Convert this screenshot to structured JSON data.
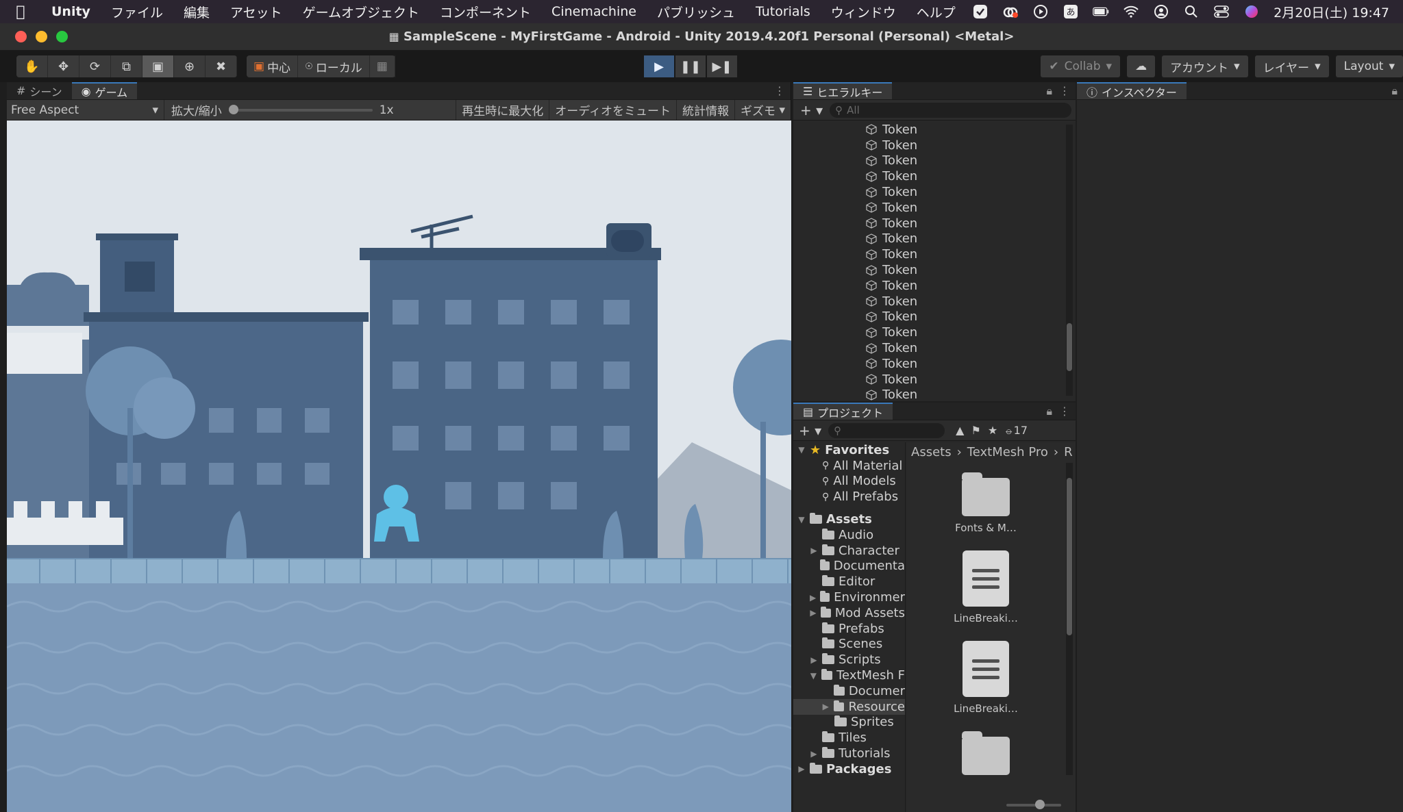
{
  "menubar": {
    "items": [
      "Unity",
      "ファイル",
      "編集",
      "アセット",
      "ゲームオブジェクト",
      "コンポーネント",
      "Cinemachine",
      "パブリッシュ",
      "Tutorials",
      "ウィンドウ",
      "ヘルプ"
    ],
    "clock": "2月20日(土)  19:47",
    "icons": [
      "checkmark-icon",
      "creative-cloud-icon",
      "play-circle-icon",
      "input-method-icon",
      "battery-icon",
      "wifi-icon",
      "user-icon",
      "search-icon",
      "control-center-icon",
      "siri-icon"
    ]
  },
  "window": {
    "title": "SampleScene - MyFirstGame - Android - Unity 2019.4.20f1 Personal (Personal) <Metal>"
  },
  "toolbar": {
    "pivot_label": "中心",
    "space_label": "ローカル",
    "collab_label": "Collab",
    "account_label": "アカウント",
    "layers_label": "レイヤー",
    "layout_label": "Layout"
  },
  "gameview": {
    "tabs": [
      "シーン",
      "ゲーム"
    ],
    "aspect": "Free Aspect",
    "scale_label": "拡大/縮小",
    "scale_value": "1x",
    "buttons": [
      "再生時に最大化",
      "オーディオをミュート",
      "統計情報",
      "ギズモ"
    ]
  },
  "hierarchy": {
    "title": "ヒエラルキー",
    "search_placeholder": "All",
    "items": [
      "Token",
      "Token",
      "Token",
      "Token",
      "Token",
      "Token",
      "Token",
      "Token",
      "Token",
      "Token",
      "Token",
      "Token",
      "Token",
      "Token",
      "Token",
      "Token",
      "Token",
      "Token"
    ]
  },
  "project": {
    "title": "プロジェクト",
    "hidden_count": "17",
    "favorites": {
      "label": "Favorites",
      "items": [
        "All Material",
        "All Models",
        "All Prefabs"
      ]
    },
    "assets": {
      "label": "Assets",
      "items": [
        {
          "label": "Audio",
          "arrow": false,
          "depth": 1
        },
        {
          "label": "Character",
          "arrow": true,
          "depth": 1
        },
        {
          "label": "Documenta",
          "arrow": false,
          "depth": 1
        },
        {
          "label": "Editor",
          "arrow": false,
          "depth": 1
        },
        {
          "label": "Environmer",
          "arrow": true,
          "depth": 1
        },
        {
          "label": "Mod Assets",
          "arrow": true,
          "depth": 1
        },
        {
          "label": "Prefabs",
          "arrow": false,
          "depth": 1
        },
        {
          "label": "Scenes",
          "arrow": false,
          "depth": 1
        },
        {
          "label": "Scripts",
          "arrow": true,
          "depth": 1
        },
        {
          "label": "TextMesh F",
          "arrow": true,
          "depth": 1,
          "open": true
        },
        {
          "label": "Documer",
          "arrow": false,
          "depth": 2
        },
        {
          "label": "Resource",
          "arrow": true,
          "depth": 2,
          "selected": true
        },
        {
          "label": "Sprites",
          "arrow": false,
          "depth": 2
        },
        {
          "label": "Tiles",
          "arrow": false,
          "depth": 1
        },
        {
          "label": "Tutorials",
          "arrow": true,
          "depth": 1
        }
      ]
    },
    "packages_label": "Packages",
    "breadcrumb": [
      "Assets",
      "TextMesh Pro",
      "R"
    ],
    "grid_items": [
      {
        "label": "Fonts & M…",
        "kind": "folder"
      },
      {
        "label": "LineBreaki…",
        "kind": "doc"
      },
      {
        "label": "LineBreaki…",
        "kind": "doc"
      },
      {
        "label": "",
        "kind": "folder"
      }
    ]
  },
  "inspector": {
    "title": "インスペクター"
  }
}
